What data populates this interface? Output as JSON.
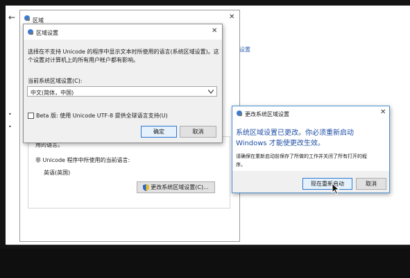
{
  "bg": {
    "link_text": "设置",
    "back_glyph": "←",
    "bullet_glyph": "•"
  },
  "region_window": {
    "title": "区域",
    "close_glyph": "✕",
    "partial_text": "用的语言。",
    "non_unicode_label": "非 Unicode 程序中所使用的当前语言:",
    "current_language": "英语(英国)",
    "change_button": "更改系统区域设置(C)..."
  },
  "locale_dialog": {
    "title": "区域设置",
    "close_glyph": "✕",
    "description_line1": "选择在不支持 Unicode 的程序中显示文本时所使用的语言(系统区域设置)。这",
    "description_line2": "个设置对计算机上的所有用户帐户都有影响。",
    "locale_label": "当前系统区域设置(C):",
    "locale_value": "中文(简体，中国)",
    "beta_label": "Beta 版: 使用 Unicode UTF-8 提供全球语言支持(U)",
    "beta_checked": false,
    "ok_button": "确定",
    "cancel_button": "取消"
  },
  "change_dialog": {
    "title": "更改系统区域设置",
    "close_glyph": "✕",
    "headline1": "系统区域设置已更改。你必须重新启动",
    "headline2": "Windows 才能使更改生效。",
    "note_line1": "请确保在重新启动前保存了所做的工作并关闭了所有打开的程",
    "note_line2": "序。",
    "restart_button": "现在重新启动",
    "cancel_button": "取消"
  },
  "icons": {
    "window_icon": "globe-settings-icon",
    "shield": "uac-shield-icon",
    "cursor": "mouse-pointer-icon",
    "dropdown": "chevron-down-icon"
  },
  "colors": {
    "headline_blue": "#1f4fa5",
    "link_blue": "#2a5fb0",
    "dialog_bg": "#f0f0f0",
    "default_button_border": "#2f78d0"
  }
}
